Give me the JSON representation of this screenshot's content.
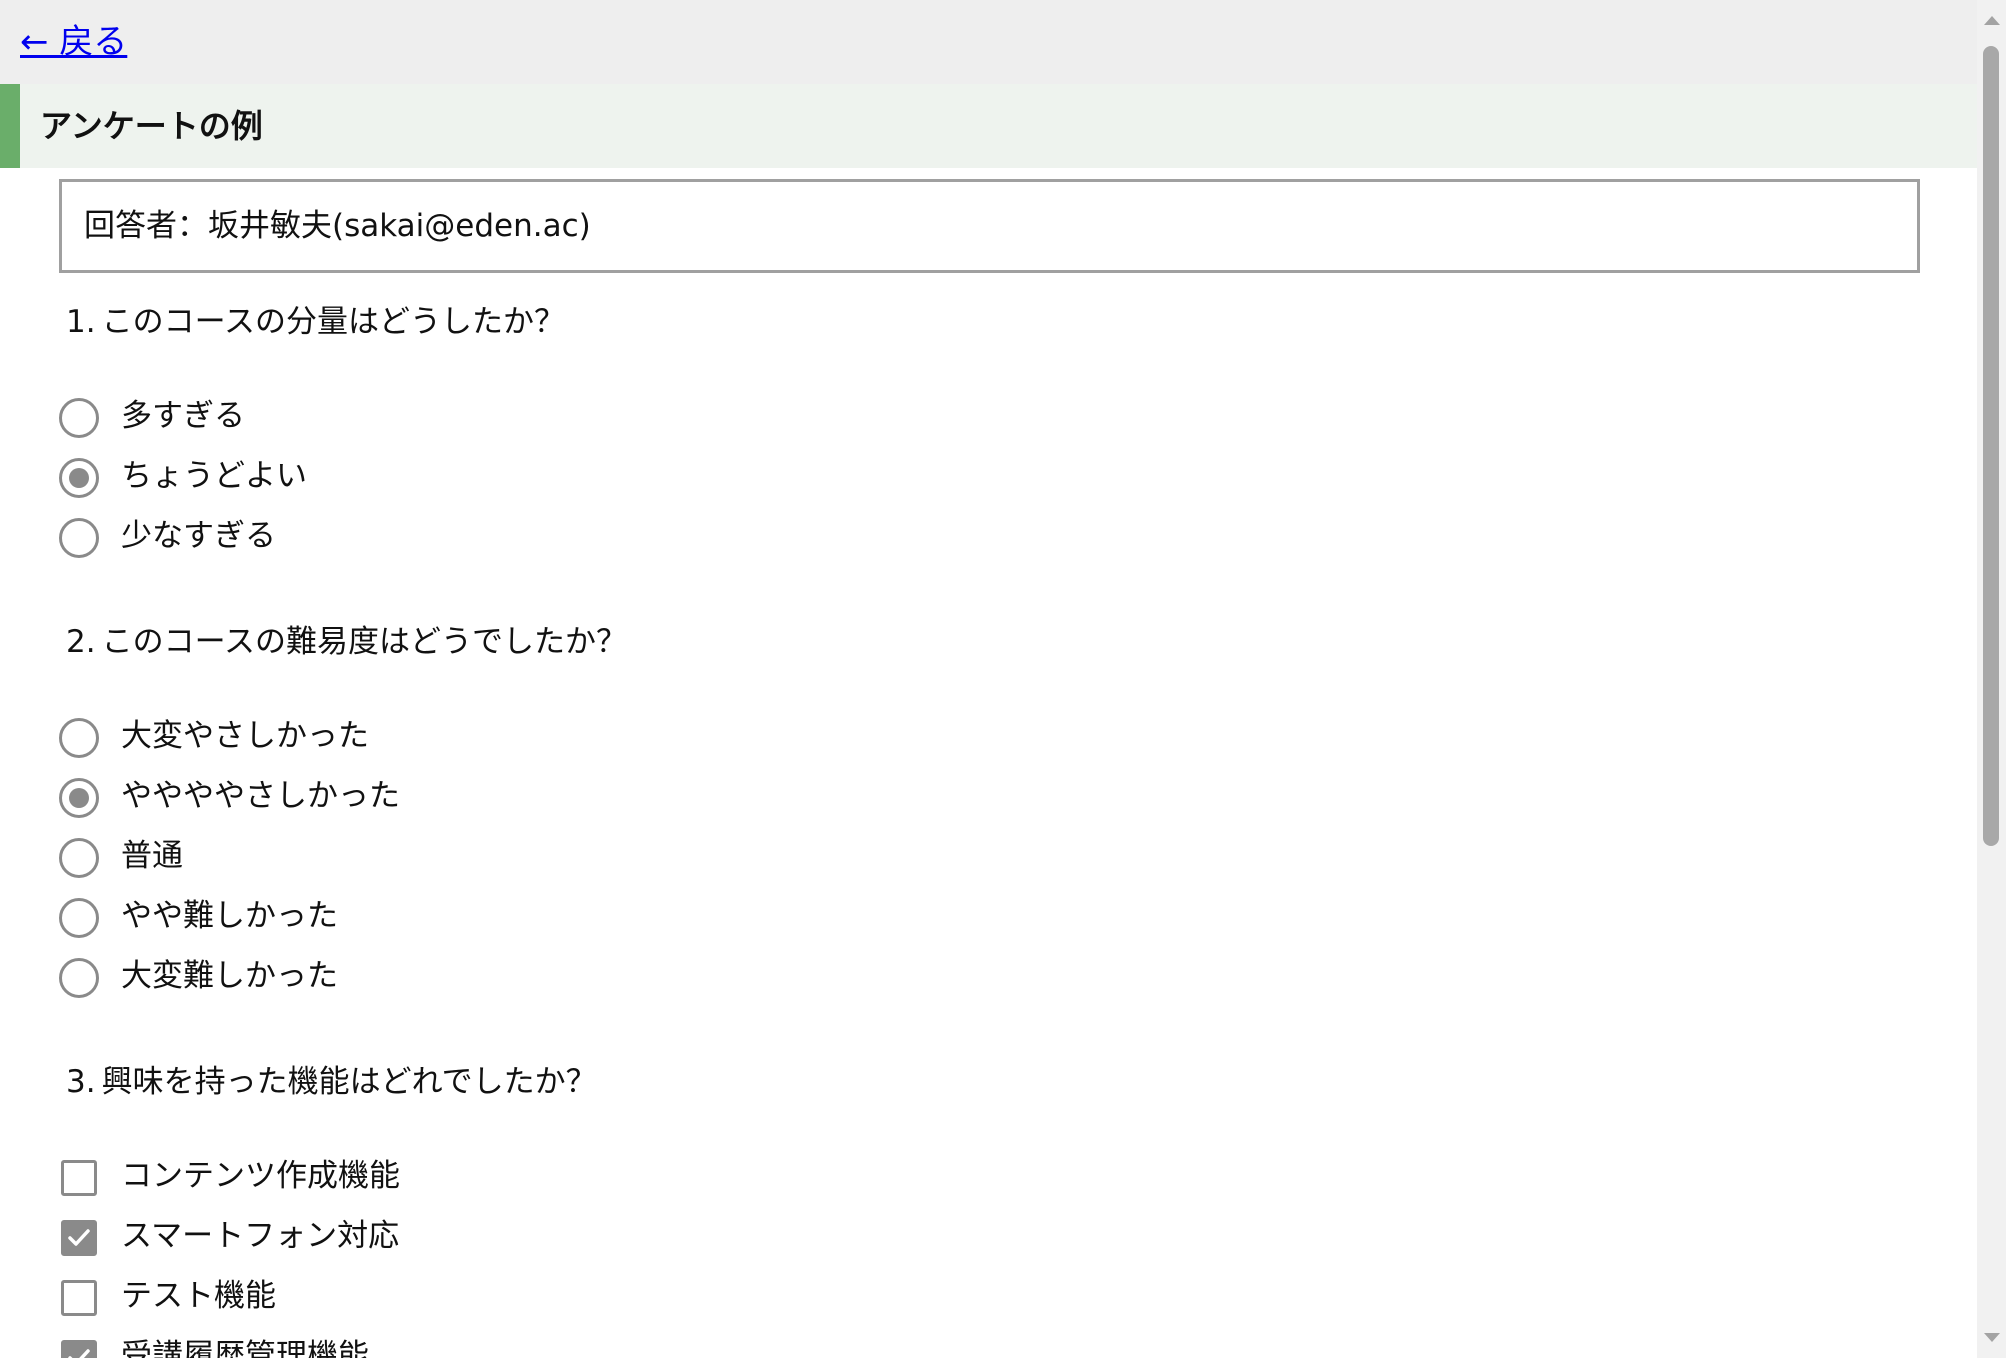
{
  "nav": {
    "back_label": "← 戻る"
  },
  "page": {
    "title": "アンケートの例"
  },
  "respondent": {
    "text": "回答者：坂井敏夫(sakai@eden.ac)"
  },
  "questions": [
    {
      "number": "1.",
      "text": "このコースの分量はどうしたか？",
      "type": "radio",
      "options": [
        {
          "label": "多すぎる",
          "selected": false
        },
        {
          "label": "ちょうどよい",
          "selected": true
        },
        {
          "label": "少なすぎる",
          "selected": false
        }
      ]
    },
    {
      "number": "2.",
      "text": "このコースの難易度はどうでしたか？",
      "type": "radio",
      "options": [
        {
          "label": "大変やさしかった",
          "selected": false
        },
        {
          "label": "ややややさしかった",
          "selected": true
        },
        {
          "label": "普通",
          "selected": false
        },
        {
          "label": "やや難しかった",
          "selected": false
        },
        {
          "label": "大変難しかった",
          "selected": false
        }
      ]
    },
    {
      "number": "3.",
      "text": "興味を持った機能はどれでしたか？",
      "type": "checkbox",
      "options": [
        {
          "label": "コンテンツ作成機能",
          "selected": false
        },
        {
          "label": "スマートフォン対応",
          "selected": true
        },
        {
          "label": "テスト機能",
          "selected": false
        },
        {
          "label": "受講履歴管理機能",
          "selected": true
        }
      ]
    }
  ],
  "colors": {
    "accent": "#6aae6a",
    "title_bg": "#eef3ee",
    "topbar_bg": "#eeeeee",
    "link": "#0000ee",
    "control": "#8a8a8a"
  },
  "icons": {
    "radio_selected": "radio-selected-icon",
    "radio_unselected": "radio-unselected-icon",
    "checkbox_checked": "checkbox-checked-icon",
    "checkbox_unchecked": "checkbox-unchecked-icon"
  }
}
